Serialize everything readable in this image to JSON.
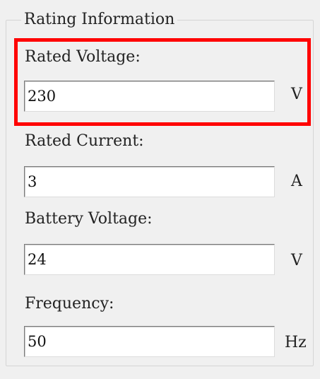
{
  "group": {
    "title": "Rating Information"
  },
  "fields": [
    {
      "label": "Rated Voltage:",
      "value": "230",
      "unit": "V"
    },
    {
      "label": "Rated Current:",
      "value": "3",
      "unit": "A"
    },
    {
      "label": "Battery Voltage:",
      "value": "24",
      "unit": "V"
    },
    {
      "label": "Frequency:",
      "value": "50",
      "unit": "Hz"
    }
  ],
  "highlight": {
    "color": "#ff0000",
    "target": "Rated Voltage"
  }
}
